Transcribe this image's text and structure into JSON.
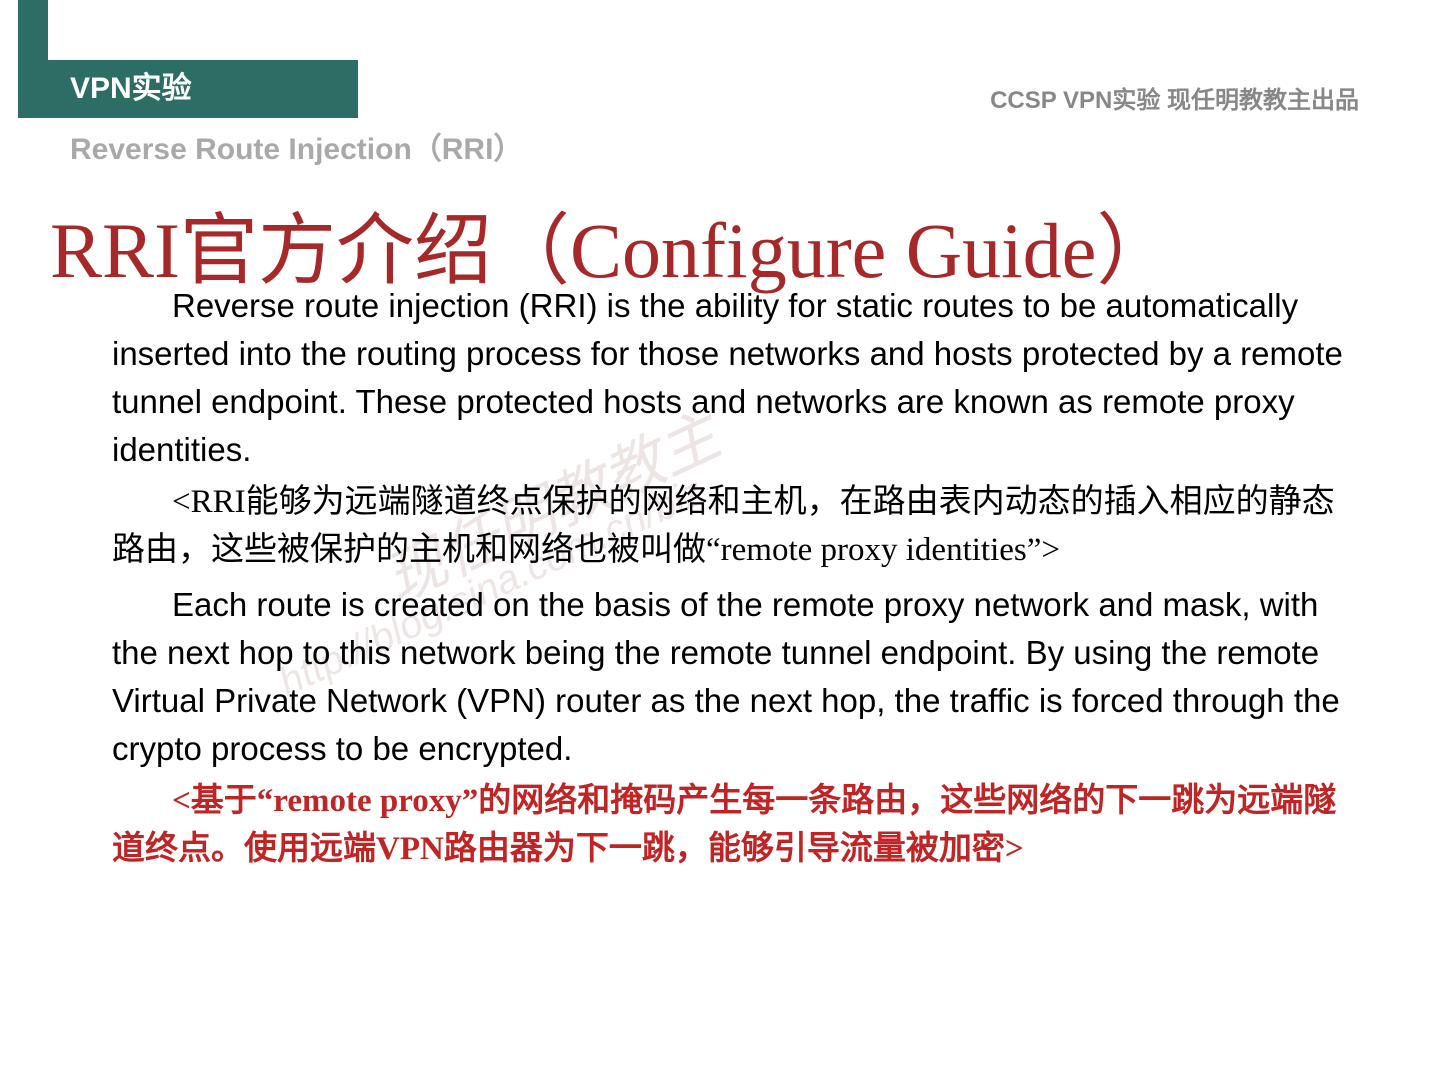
{
  "header": {
    "ribbon_label": "VPN实验",
    "right_label": "CCSP VPN实验 现任明教教主出品",
    "subheader": "Reverse Route Injection（RRI）"
  },
  "title": "RRI官方介绍（Configure Guide）",
  "paragraphs": {
    "p1": "Reverse route injection (RRI) is the ability for static routes to be automatically inserted into the routing process for those networks and hosts protected by a remote tunnel endpoint. These protected hosts and networks are known as remote proxy identities.",
    "p2": "<RRI能够为远端隧道终点保护的网络和主机，在路由表内动态的插入相应的静态路由，这些被保护的主机和网络也被叫做“remote proxy identities”>",
    "p3": "Each route is created on the basis of the remote proxy network and mask, with the next hop to this network being the remote tunnel endpoint. By using the remote Virtual Private Network (VPN) router as the next hop, the traffic is forced through the crypto process to be encrypted.",
    "p4": "<基于“remote proxy”的网络和掩码产生每一条路由，这些网络的下一跳为远端隧道终点。使用远端VPN路由器为下一跳，能够引导流量被加密>"
  },
  "watermark": {
    "name": "现任明教教主",
    "url": "http://blog.sina.com.cn/biz"
  }
}
